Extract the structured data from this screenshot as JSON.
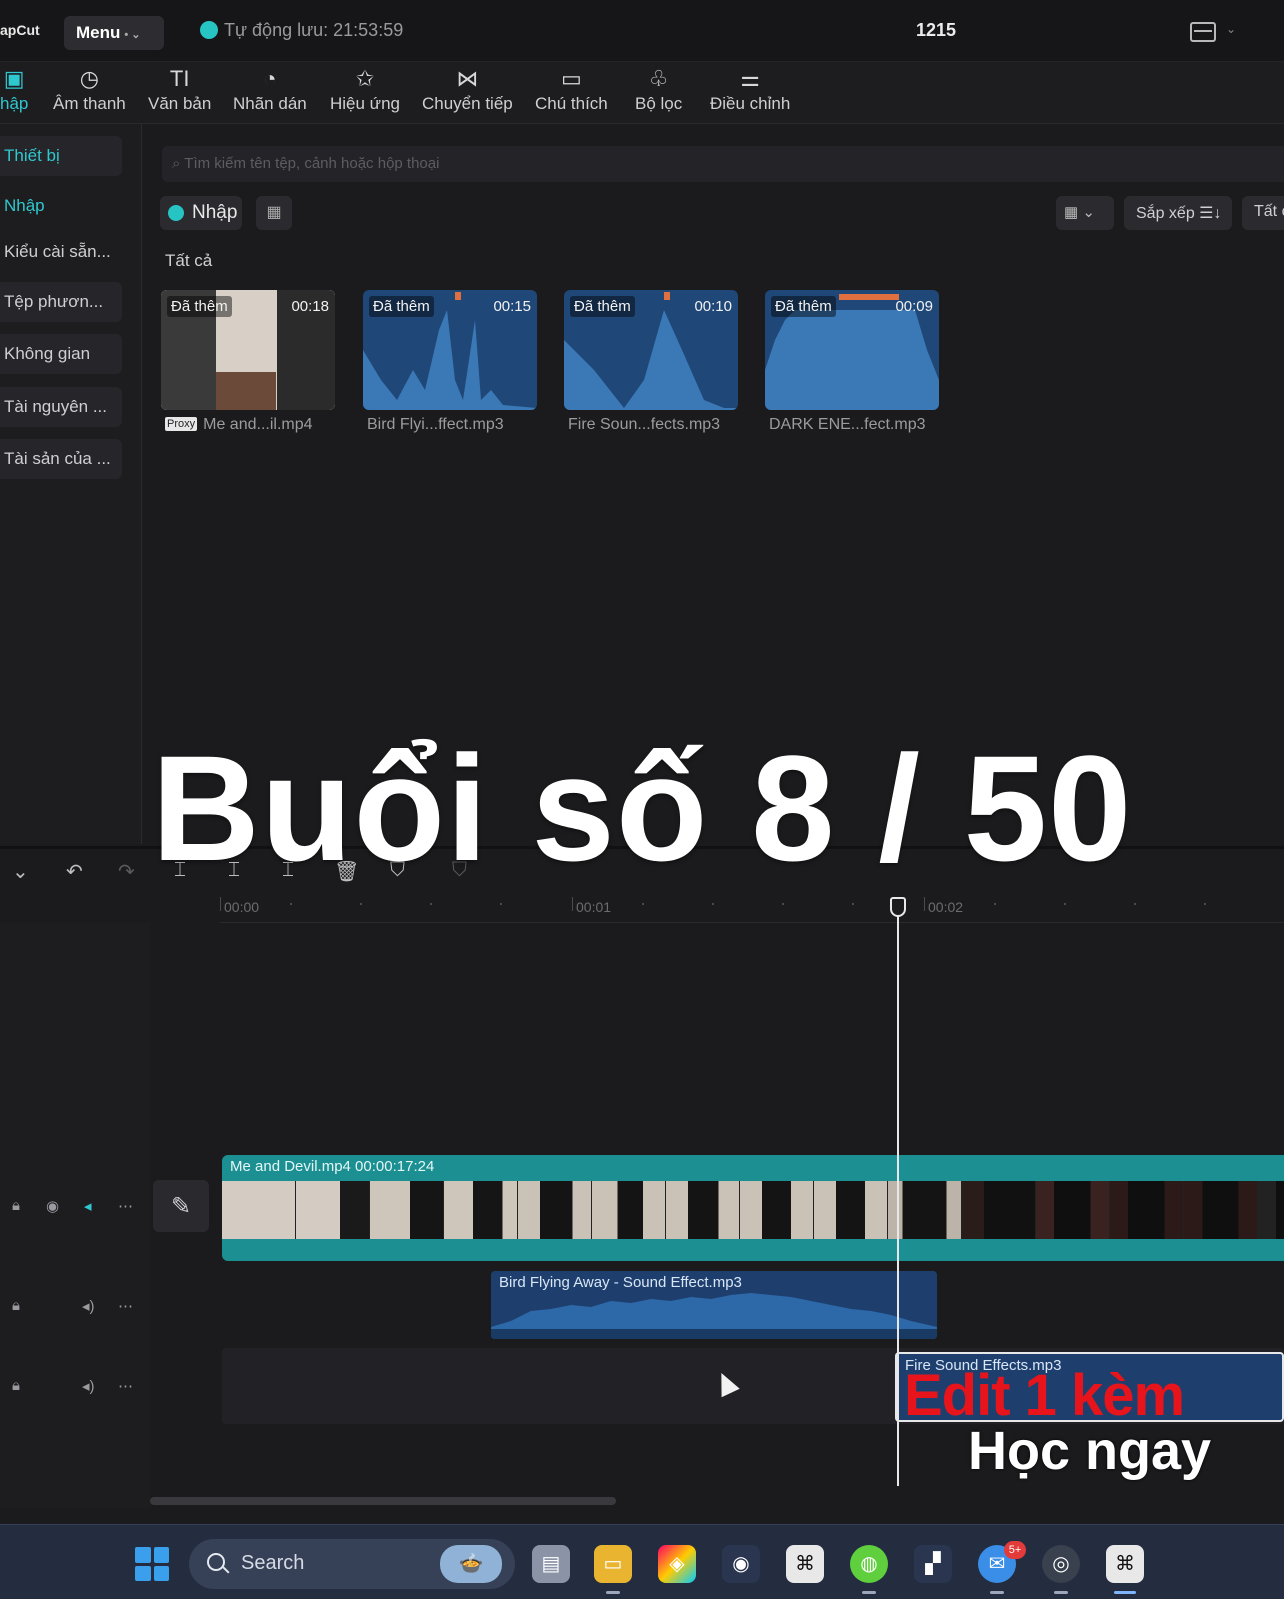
{
  "titlebar": {
    "app_name": "apCut",
    "menu_label": "Menu",
    "autosave_text": "Tự động lưu: 21:53:59",
    "project_name": "1215"
  },
  "toolbar": {
    "tabs": [
      {
        "label": "hập",
        "icon": "import-icon",
        "glyph": "▣",
        "active": true
      },
      {
        "label": "Âm thanh",
        "icon": "audio-icon",
        "glyph": "◷"
      },
      {
        "label": "Văn bản",
        "icon": "text-icon",
        "glyph": "TI"
      },
      {
        "label": "Nhãn dán",
        "icon": "sticker-icon",
        "glyph": "◔"
      },
      {
        "label": "Hiệu ứng",
        "icon": "effects-icon",
        "glyph": "✩"
      },
      {
        "label": "Chuyển tiếp",
        "icon": "transition-icon",
        "glyph": "⋈"
      },
      {
        "label": "Chú thích",
        "icon": "caption-icon",
        "glyph": "▭"
      },
      {
        "label": "Bộ lọc",
        "icon": "filter-icon",
        "glyph": "♧"
      },
      {
        "label": "Điều chỉnh",
        "icon": "adjust-icon",
        "glyph": "⚌"
      }
    ]
  },
  "sidebar": {
    "items": [
      {
        "label": "Thiết bị",
        "active": true,
        "boxed": true
      },
      {
        "label": "Nhập",
        "active": true,
        "boxed": false
      },
      {
        "label": "Kiểu cài sẵn...",
        "active": false,
        "boxed": false
      },
      {
        "label": "Tệp phươn...",
        "active": false,
        "boxed": true
      },
      {
        "label": "Không gian",
        "active": false,
        "boxed": true
      },
      {
        "label": "Tài nguyên ...",
        "active": false,
        "boxed": true
      },
      {
        "label": "Tài sản của ...",
        "active": false,
        "boxed": true
      }
    ]
  },
  "media": {
    "search_placeholder": "Tìm kiếm tên tệp, cảnh hoặc hộp thoại",
    "import_label": "Nhập",
    "sort_label": "Sắp xếp ☰↓",
    "all_label": "Tất c",
    "section_label": "Tất cả",
    "proxy_tag": "Proxy",
    "items": [
      {
        "badge": "Đã thêm",
        "duration": "00:18",
        "name": "Me and...il.mp4",
        "type": "video"
      },
      {
        "badge": "Đã thêm",
        "duration": "00:15",
        "name": "Bird Flyi...ffect.mp3",
        "type": "audio"
      },
      {
        "badge": "Đã thêm",
        "duration": "00:10",
        "name": "Fire Soun...fects.mp3",
        "type": "audio"
      },
      {
        "badge": "Đã thêm",
        "duration": "00:09",
        "name": "DARK ENE...fect.mp3",
        "type": "audio"
      }
    ]
  },
  "overlay": {
    "title": "Buổi số 8 / 50",
    "promo_red": "Edit 1 kèm",
    "promo_white": "Học ngay"
  },
  "timeline": {
    "ruler_labels": [
      "00:00",
      "00:01",
      "00:02"
    ],
    "video_clip_label": "Me and Devil.mp4   00:00:17:24",
    "audio_clip_1_label": "Bird Flying Away - Sound Effect.mp3",
    "audio_clip_2_label": "Fire Sound Effects.mp3"
  },
  "taskbar": {
    "search_label": "Search",
    "badge_count": "5+"
  }
}
